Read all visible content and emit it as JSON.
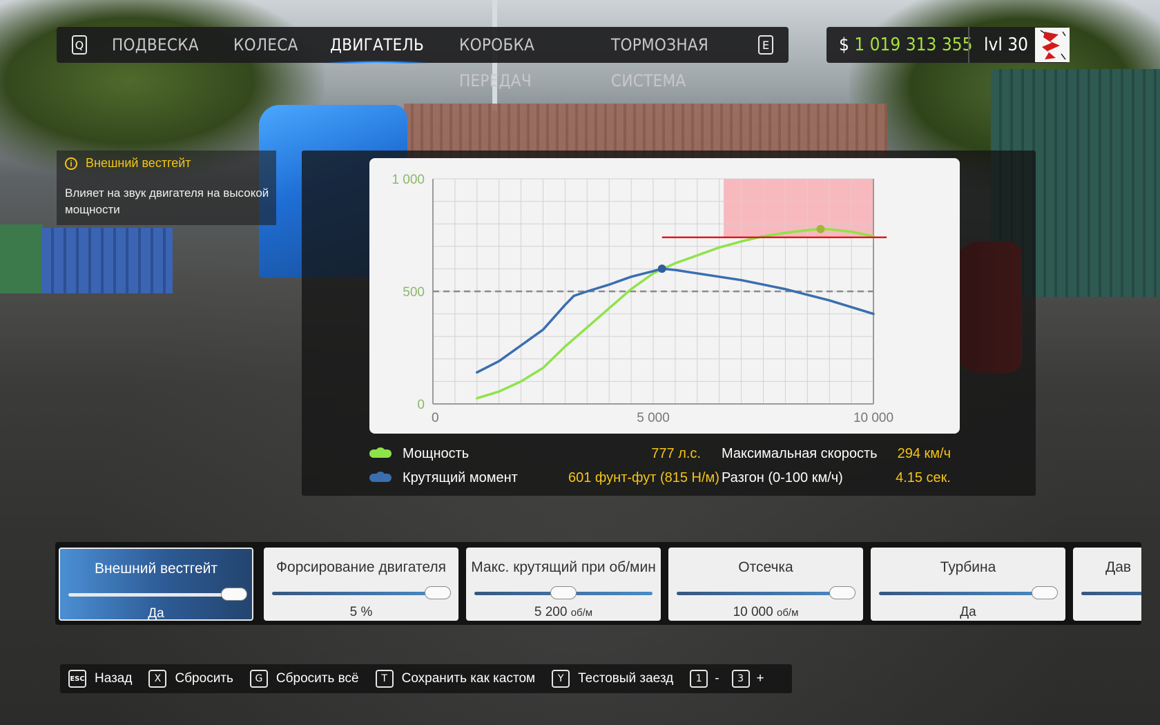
{
  "topbar": {
    "left_key": "Q",
    "right_key": "E",
    "tabs": [
      {
        "label": "ПОДВЕСКА",
        "active": false
      },
      {
        "label": "КОЛЕСА",
        "active": false
      },
      {
        "label": "ДВИГАТЕЛЬ",
        "active": true
      },
      {
        "label": "КОРОБКА ПЕРЕДАЧ",
        "active": false
      },
      {
        "label": "ТОРМОЗНАЯ СИСТЕМА",
        "active": false
      }
    ]
  },
  "player": {
    "currency": "$",
    "money": "1 019 313 355",
    "level": "lvl 30"
  },
  "info": {
    "icon": "info-icon",
    "title": "Внешний вестгейт",
    "text": "Влияет на звук двигателя на высокой мощности"
  },
  "chart_data": {
    "type": "line",
    "xlim": [
      0,
      10000
    ],
    "ylim": [
      0,
      1000
    ],
    "x_ticks": [
      "0",
      "5 000",
      "10 000"
    ],
    "y_ticks": [
      "0",
      "500",
      "1 000"
    ],
    "grid": true,
    "reference_line_y": 500,
    "highlight_region": {
      "x": [
        6600,
        10000
      ],
      "y": [
        740,
        1000
      ],
      "color": "#f7b3b8"
    },
    "power_limit_line": {
      "y": 740,
      "x": [
        5200,
        10300
      ],
      "color": "#e11a1a"
    },
    "series": [
      {
        "name": "Мощность",
        "color": "#8fe34a",
        "x": [
          1000,
          1500,
          2000,
          2500,
          3000,
          3500,
          4000,
          4500,
          5000,
          5500,
          6000,
          6500,
          7000,
          7500,
          8000,
          8500,
          8800,
          9000,
          9500,
          10000
        ],
        "y": [
          25,
          55,
          100,
          160,
          255,
          340,
          425,
          510,
          580,
          625,
          660,
          695,
          722,
          745,
          760,
          772,
          777,
          776,
          765,
          745
        ],
        "peak": {
          "x": 8800,
          "y": 777
        }
      },
      {
        "name": "Крутящий момент",
        "color": "#3a6eb0",
        "x": [
          1000,
          1500,
          2000,
          2500,
          3000,
          3200,
          3500,
          4000,
          4500,
          5000,
          5200,
          5500,
          6000,
          6500,
          7000,
          7500,
          8000,
          8500,
          9000,
          9500,
          10000
        ],
        "y": [
          140,
          190,
          260,
          330,
          440,
          480,
          500,
          530,
          565,
          590,
          601,
          595,
          580,
          565,
          550,
          530,
          510,
          485,
          460,
          430,
          400
        ],
        "peak": {
          "x": 5200,
          "y": 601
        }
      }
    ]
  },
  "legend": {
    "power_label": "Мощность",
    "power_value": "777 л.с.",
    "torque_label": "Крутящий момент",
    "torque_value": "601 фунт-фут (815 Н/м)",
    "speed_label": "Максимальная скорость",
    "speed_value": "294 км/ч",
    "accel_label": "Разгон (0-100 км/ч)",
    "accel_value": "4.15 сек.",
    "power_color": "#8fe34a",
    "torque_color": "#3a6eb0"
  },
  "sliders": [
    {
      "title": "Внешний вестгейт",
      "value": "Да",
      "unit": "",
      "level": 0.93,
      "selected": true
    },
    {
      "title": "Форсирование двигателя",
      "value": "5 %",
      "unit": "",
      "level": 0.93,
      "selected": false
    },
    {
      "title": "Макс. крутящий при об/мин",
      "value": "5 200 ",
      "unit": "об/м",
      "level": 0.5,
      "selected": false
    },
    {
      "title": "Отсечка",
      "value": "10 000 ",
      "unit": "об/м",
      "level": 0.93,
      "selected": false
    },
    {
      "title": "Турбина",
      "value": "Да",
      "unit": "",
      "level": 0.93,
      "selected": false
    },
    {
      "title": "Дав",
      "value": "",
      "unit": "",
      "level": 0.9,
      "selected": false
    }
  ],
  "keybar": [
    {
      "key": "ESC",
      "label": "Назад"
    },
    {
      "key": "X",
      "label": "Сбросить"
    },
    {
      "key": "G",
      "label": "Сбросить всё"
    },
    {
      "key": "T",
      "label": "Сохранить как кастом"
    },
    {
      "key": "Y",
      "label": "Тестовый заезд"
    }
  ],
  "page_keys": {
    "prev_key": "1",
    "prev_sign": "-",
    "next_key": "3",
    "next_sign": "+"
  }
}
